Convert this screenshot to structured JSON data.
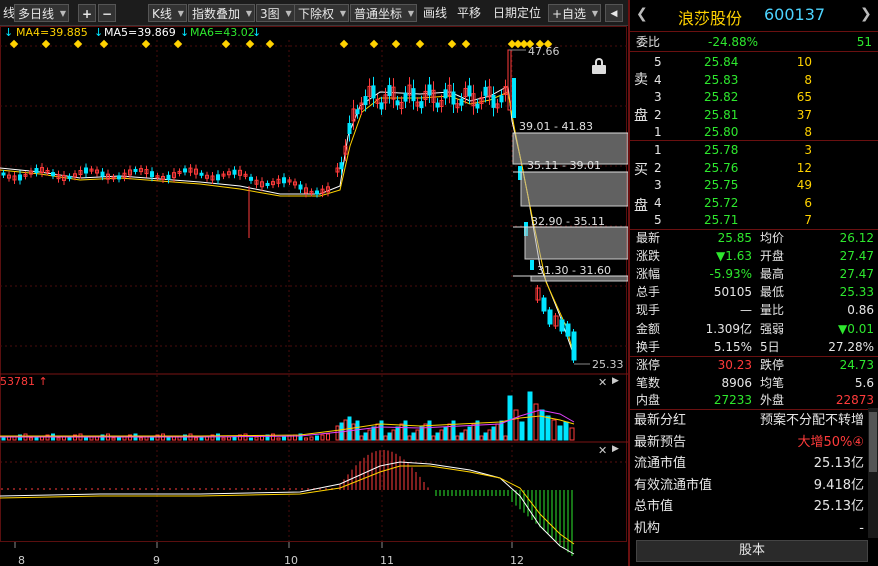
{
  "toolbar": {
    "period_prefix": "线",
    "period": "多日线",
    "plus": "+",
    "minus": "−",
    "kline": "K线",
    "indicator": "指数叠加",
    "charts": "3图",
    "fq": "下除权",
    "coord": "普通坐标",
    "draw": "画线",
    "pan": "平移",
    "date_locate": "日期定位",
    "watchlist": "+自选",
    "nav_left": "◀",
    "nav_right": "▶"
  },
  "ma": {
    "ma4": "MA4=39.885",
    "ma5": "MA5=39.869",
    "ma6": "MA6=43.02"
  },
  "price_labels": {
    "high": "47.66",
    "low": "25.33"
  },
  "zones": [
    {
      "label": "39.01 - 41.83"
    },
    {
      "label": "35.11 - 39.01"
    },
    {
      "label": "32.90 - 35.11"
    },
    {
      "label": "31.30 - 31.60"
    }
  ],
  "volume": {
    "label": "53781",
    "up_arrow": "↑"
  },
  "x_ticks": [
    "8",
    "9",
    "10",
    "11",
    "12"
  ],
  "colors": {
    "up": "#ff3b3b",
    "down": "#00e5ff",
    "ma_yellow": "#ffd200",
    "ma_white": "#ffffff",
    "macd_green": "#2ee82e",
    "zone": "#9a9a9a"
  },
  "panel": {
    "name": "浪莎股份",
    "code": "600137",
    "weibi_label": "委比",
    "weibi": "-24.88%",
    "weicha": "51",
    "sell_side": "卖盘",
    "buy_side": "买盘",
    "sell": [
      {
        "lvl": "5",
        "price": "25.84",
        "vol": "10"
      },
      {
        "lvl": "4",
        "price": "25.83",
        "vol": "8"
      },
      {
        "lvl": "3",
        "price": "25.82",
        "vol": "65"
      },
      {
        "lvl": "2",
        "price": "25.81",
        "vol": "37"
      },
      {
        "lvl": "1",
        "price": "25.80",
        "vol": "8"
      }
    ],
    "buy": [
      {
        "lvl": "1",
        "price": "25.78",
        "vol": "3"
      },
      {
        "lvl": "2",
        "price": "25.76",
        "vol": "12"
      },
      {
        "lvl": "3",
        "price": "25.75",
        "vol": "49"
      },
      {
        "lvl": "4",
        "price": "25.72",
        "vol": "6"
      },
      {
        "lvl": "5",
        "price": "25.71",
        "vol": "7"
      }
    ],
    "stats": [
      {
        "k1": "最新",
        "v1": "25.85",
        "c1": "green",
        "k2": "均价",
        "v2": "26.12",
        "c2": "green"
      },
      {
        "k1": "涨跌",
        "v1": "▼1.63",
        "c1": "green",
        "k2": "开盘",
        "v2": "27.47",
        "c2": "green"
      },
      {
        "k1": "涨幅",
        "v1": "-5.93%",
        "c1": "green",
        "k2": "最高",
        "v2": "27.47",
        "c2": "green"
      },
      {
        "k1": "总手",
        "v1": "50105",
        "c1": "white",
        "k2": "最低",
        "v2": "25.33",
        "c2": "green"
      },
      {
        "k1": "现手",
        "v1": "—",
        "c1": "white",
        "k2": "量比",
        "v2": "0.86",
        "c2": "white"
      },
      {
        "k1": "金额",
        "v1": "1.309亿",
        "c1": "white",
        "k2": "强弱",
        "v2": "▼0.01",
        "c2": "green"
      },
      {
        "k1": "换手",
        "v1": "5.15%",
        "c1": "white",
        "k2": "5日",
        "v2": "27.28%",
        "c2": "white"
      }
    ],
    "limits": [
      {
        "k1": "涨停",
        "v1": "30.23",
        "c1": "red",
        "k2": "跌停",
        "v2": "24.73",
        "c2": "green"
      },
      {
        "k1": "笔数",
        "v1": "8906",
        "c1": "white",
        "k2": "均笔",
        "v2": "5.6",
        "c2": "white"
      },
      {
        "k1": "内盘",
        "v1": "27233",
        "c1": "green",
        "k2": "外盘",
        "v2": "22873",
        "c2": "red"
      }
    ],
    "info": [
      {
        "k": "最新分红",
        "v": "预案不分配不转增",
        "c": "white"
      },
      {
        "k": "最新预告",
        "v": "大增50%④",
        "c": "red"
      },
      {
        "k": "流通市值",
        "v": "25.13亿",
        "c": "white"
      },
      {
        "k": "有效流通市值",
        "v": "9.418亿",
        "c": "white"
      },
      {
        "k": "总市值",
        "v": "25.13亿",
        "c": "white"
      },
      {
        "k": "机构",
        "v": "-",
        "c": "white"
      }
    ],
    "bottom_tab": "股本"
  }
}
